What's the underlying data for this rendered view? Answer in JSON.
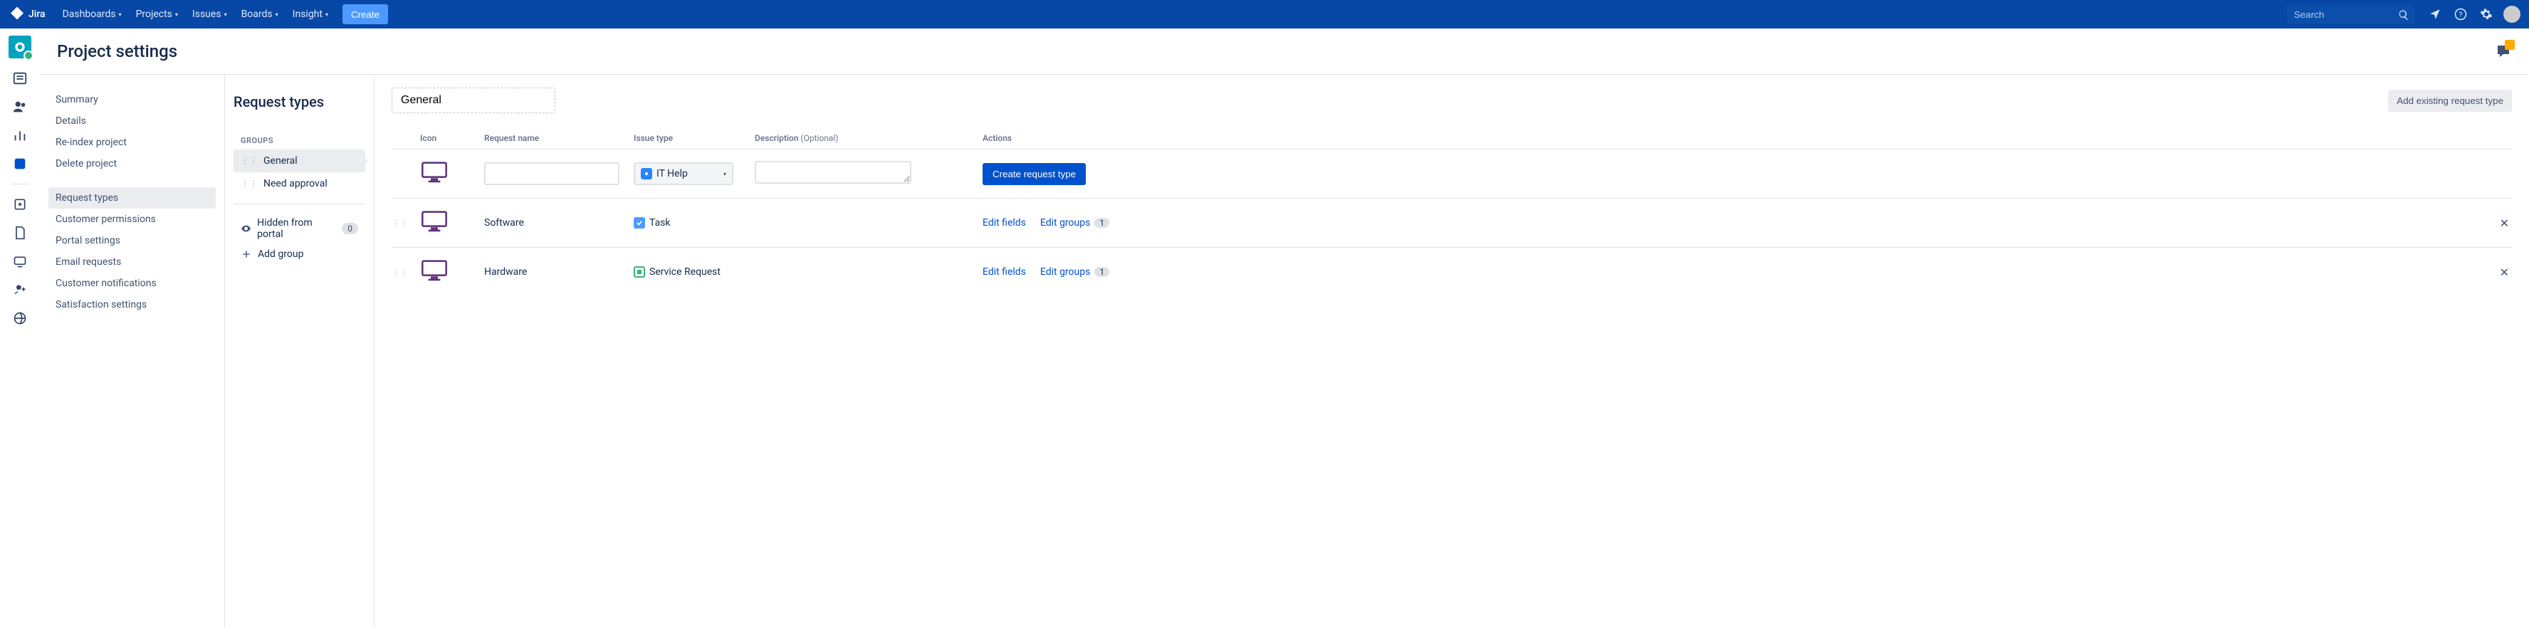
{
  "nav": {
    "logo": "Jira",
    "items": [
      "Dashboards",
      "Projects",
      "Issues",
      "Boards",
      "Insight"
    ],
    "create": "Create",
    "search_placeholder": "Search"
  },
  "page_title": "Project settings",
  "rail": {
    "icons": [
      "queues-icon",
      "customers-icon",
      "reports-icon",
      "project-shortcut-icon"
    ],
    "icons2": [
      "add-shortcut-icon",
      "pages-icon",
      "raise-request-icon",
      "invite-team-icon",
      "welcome-icon"
    ]
  },
  "sidebar": {
    "items": [
      "Summary",
      "Details",
      "Re-index project",
      "Delete project"
    ],
    "items2": [
      "Request types",
      "Customer permissions",
      "Portal settings",
      "Email requests",
      "Customer notifications",
      "Satisfaction settings"
    ],
    "active": "Request types"
  },
  "groups": {
    "section_title": "Request types",
    "label": "GROUPS",
    "items": [
      "General",
      "Need approval"
    ],
    "active": "General",
    "hidden_label": "Hidden from portal",
    "hidden_count": "0",
    "add_group": "Add group"
  },
  "main": {
    "group_name": "General",
    "add_existing": "Add existing request type",
    "table": {
      "headers": {
        "icon": "Icon",
        "name": "Request name",
        "issue_type": "Issue type",
        "description": "Description",
        "description_optional": "(Optional)",
        "actions": "Actions"
      },
      "new_row": {
        "issue_type": "IT Help",
        "create_btn": "Create request type"
      },
      "rows": [
        {
          "name": "Software",
          "issue_type": "Task",
          "issue_color": "teal",
          "edit_fields": "Edit fields",
          "edit_groups": "Edit groups",
          "group_count": "1"
        },
        {
          "name": "Hardware",
          "issue_type": "Service Request",
          "issue_color": "green",
          "edit_fields": "Edit fields",
          "edit_groups": "Edit groups",
          "group_count": "1"
        }
      ]
    }
  }
}
